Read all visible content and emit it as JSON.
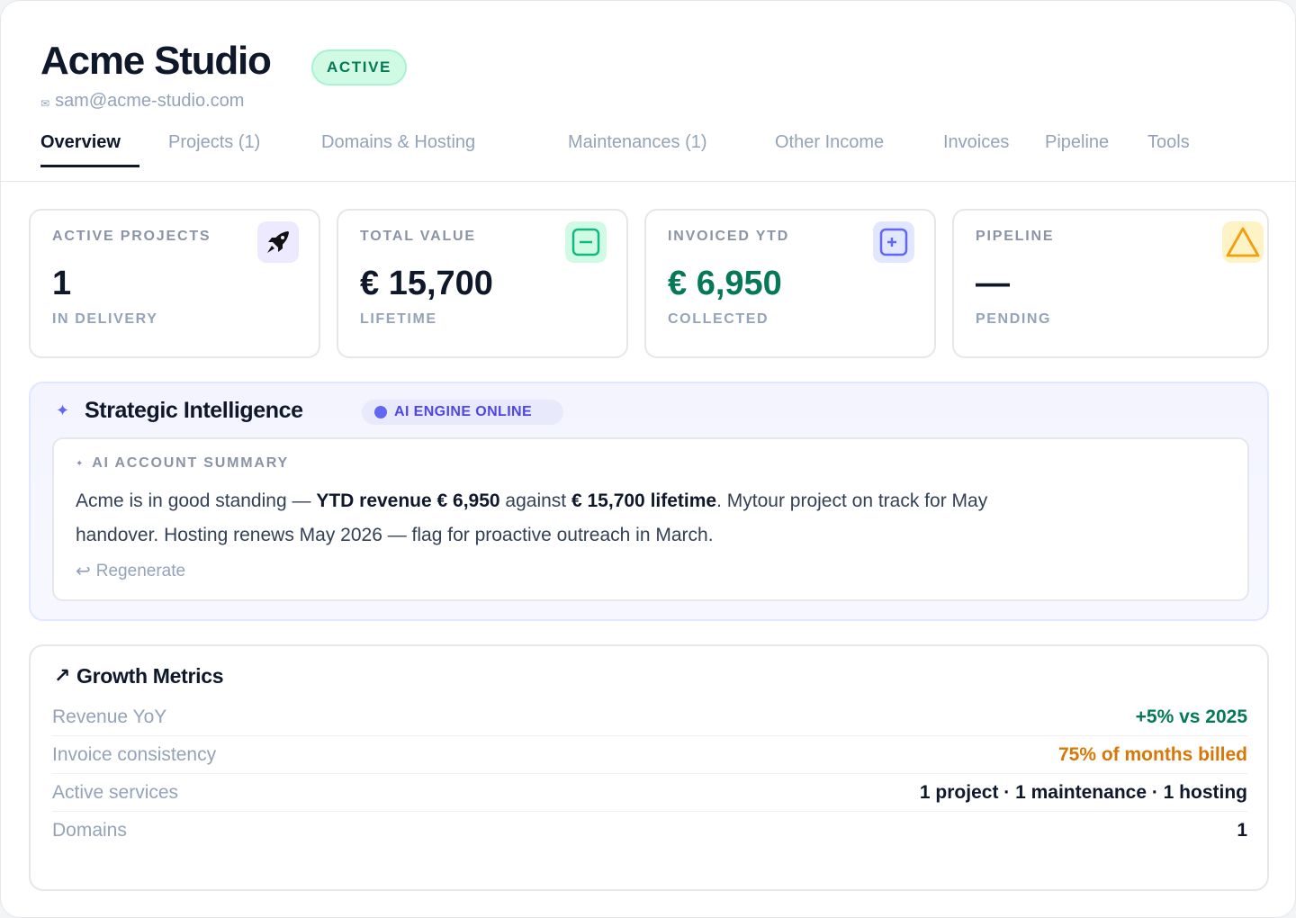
{
  "client": {
    "name": "Acme Studio",
    "status": "ACTIVE",
    "email": "sam@acme-studio.com"
  },
  "tabs": [
    {
      "label": "Overview",
      "active": true
    },
    {
      "label": "Projects (1)",
      "active": false
    },
    {
      "label": "Domains & Hosting",
      "active": false
    },
    {
      "label": "Maintenances (1)",
      "active": false
    },
    {
      "label": "Other Income",
      "active": false
    },
    {
      "label": "Invoices",
      "active": false
    },
    {
      "label": "Pipeline",
      "active": false
    },
    {
      "label": "Tools",
      "active": false
    }
  ],
  "stats": [
    {
      "label": "ACTIVE PROJECTS",
      "value": "1",
      "sub": "IN DELIVERY",
      "icon": "rocket-icon"
    },
    {
      "label": "TOTAL VALUE",
      "value": "€ 15,700",
      "sub": "LIFETIME",
      "icon": "minus-square-icon"
    },
    {
      "label": "INVOICED YTD",
      "value": "€ 6,950",
      "sub": "COLLECTED",
      "icon": "plus-square-icon"
    },
    {
      "label": "PIPELINE",
      "value": "—",
      "sub": "PENDING",
      "icon": "warning-triangle-icon"
    }
  ],
  "intelligence": {
    "title": "Strategic Intelligence",
    "engine_status": "AI ENGINE ONLINE",
    "summary_label": "AI ACCOUNT SUMMARY",
    "summary": {
      "p1": "Acme is in good standing — ",
      "b1": "YTD revenue € 6,950",
      "p2": " against ",
      "b2": "€ 15,700 lifetime",
      "p3": ". Mytour project on track for May handover. Hosting renews May 2026 — flag for proactive outreach in March."
    },
    "regenerate_label": "Regenerate"
  },
  "growth": {
    "title": "Growth Metrics",
    "rows": [
      {
        "label": "Revenue YoY",
        "value": "+5% vs 2025",
        "tone": "green"
      },
      {
        "label": "Invoice consistency",
        "value": "75% of months billed",
        "tone": "orange"
      },
      {
        "label": "Active services",
        "value": "1 project · 1 maintenance · 1 hosting",
        "tone": "default"
      },
      {
        "label": "Domains",
        "value": "1",
        "tone": "default"
      }
    ]
  },
  "colors": {
    "active_green": "#047857",
    "warning_orange": "#d97706",
    "ai_indigo": "#6366f1"
  }
}
